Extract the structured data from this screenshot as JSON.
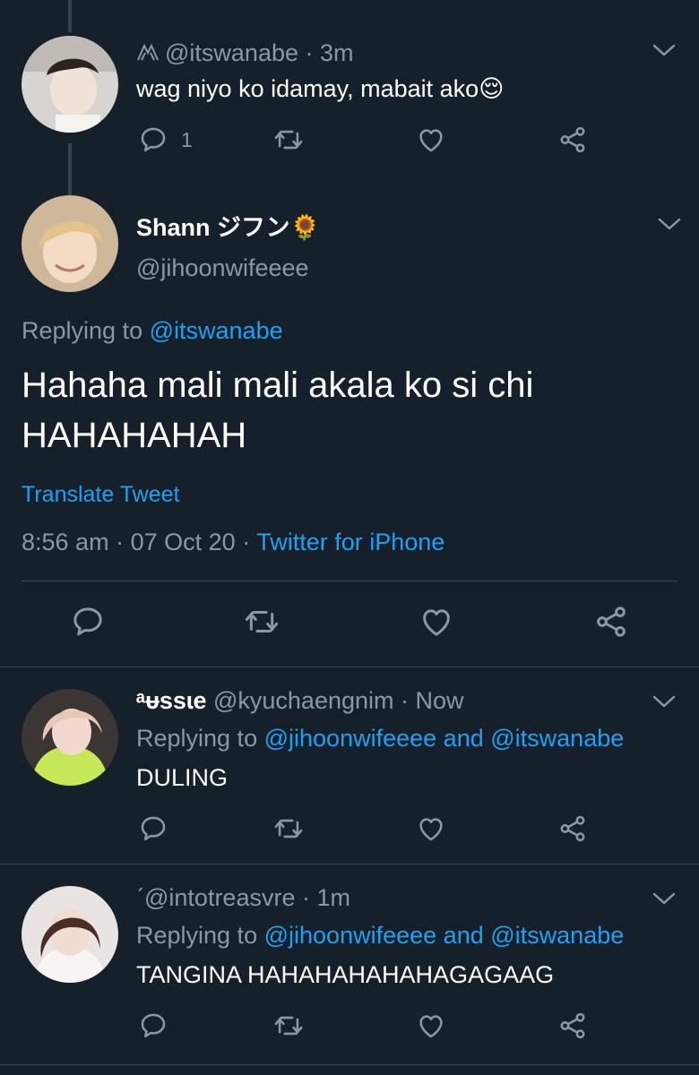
{
  "tweets": [
    {
      "handle": "@itswanabe",
      "sep": "·",
      "time": "3m",
      "text": "wag niyo ko idamay, mabait ako",
      "emoji": "😌",
      "reply_count": "1"
    }
  ],
  "focused": {
    "display_name": "Shann ジフン",
    "name_emoji": "🌻",
    "handle": "@jihoonwifeeee",
    "replying_prefix": "Replying to",
    "replying_to": "@itswanabe",
    "text_line1": "Hahaha mali mali akala ko si chi",
    "text_line2": "HAHAHAHAH",
    "translate": "Translate Tweet",
    "time": "8:56 am",
    "date": "07 Oct 20",
    "sep": "·",
    "source": "Twitter for iPhone"
  },
  "replies": [
    {
      "display_name": "ᵃᵾssɩe",
      "handle": "@kyuchaengnim",
      "sep": "·",
      "time": "Now",
      "replying_prefix": "Replying to",
      "replying_to_1": "@jihoonwifeeee",
      "and": "and",
      "replying_to_2": "@itswanabe",
      "text": "DULING"
    },
    {
      "display_name": "ˊ",
      "handle": "@intotreasvre",
      "sep": "·",
      "time": "1m",
      "replying_prefix": "Replying to",
      "replying_to_1": "@jihoonwifeeee",
      "and": "and",
      "replying_to_2": "@itswanabe",
      "text": "TANGINA HAHAHAHAHAHAGAGAAG"
    }
  ],
  "colors": {
    "background": "#15202b",
    "muted": "#8899a6",
    "link": "#1da1f2",
    "divider": "#38444d"
  },
  "icons": [
    "reply-icon",
    "retweet-icon",
    "like-icon",
    "share-icon",
    "chevron-down-icon",
    "verified-style-badge-icon"
  ]
}
